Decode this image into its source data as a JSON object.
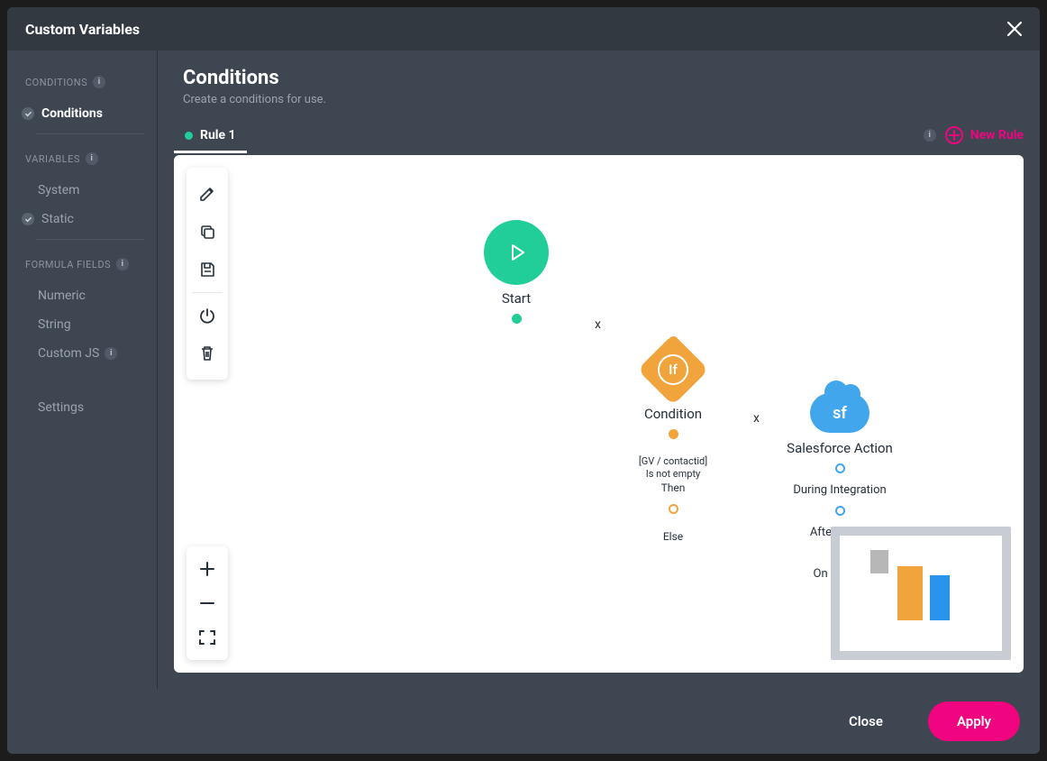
{
  "modal": {
    "title": "Custom Variables"
  },
  "sidebar": {
    "sections": [
      {
        "label": "CONDITIONS",
        "items": [
          {
            "label": "Conditions",
            "active": true,
            "checked": true
          }
        ]
      },
      {
        "label": "VARIABLES",
        "items": [
          {
            "label": "System",
            "active": false,
            "checked": false
          },
          {
            "label": "Static",
            "active": false,
            "checked": true
          }
        ]
      },
      {
        "label": "FORMULA FIELDS",
        "items": [
          {
            "label": "Numeric",
            "active": false,
            "checked": false
          },
          {
            "label": "String",
            "active": false,
            "checked": false
          },
          {
            "label": "Custom JS",
            "active": false,
            "checked": false,
            "info": true
          }
        ]
      }
    ],
    "settings_label": "Settings"
  },
  "main": {
    "title": "Conditions",
    "subtitle": "Create a conditions for use."
  },
  "tabs": {
    "rule1": "Rule 1",
    "new_rule": "New Rule"
  },
  "flow": {
    "start": {
      "label": "Start"
    },
    "condition": {
      "label": "Condition",
      "token": "If",
      "gv": "[GV / contactid]",
      "op": "Is not empty",
      "then": "Then",
      "else": "Else"
    },
    "sf": {
      "label": "Salesforce Action",
      "token": "sf",
      "during": "During Integration",
      "after": "After Finish",
      "cancel": "On Cancel"
    },
    "edge_x": "x"
  },
  "footer": {
    "close": "Close",
    "apply": "Apply"
  },
  "colors": {
    "accent": "#F0047F",
    "green": "#21CE99",
    "orange": "#f1a33c",
    "blue": "#42a6ec"
  }
}
